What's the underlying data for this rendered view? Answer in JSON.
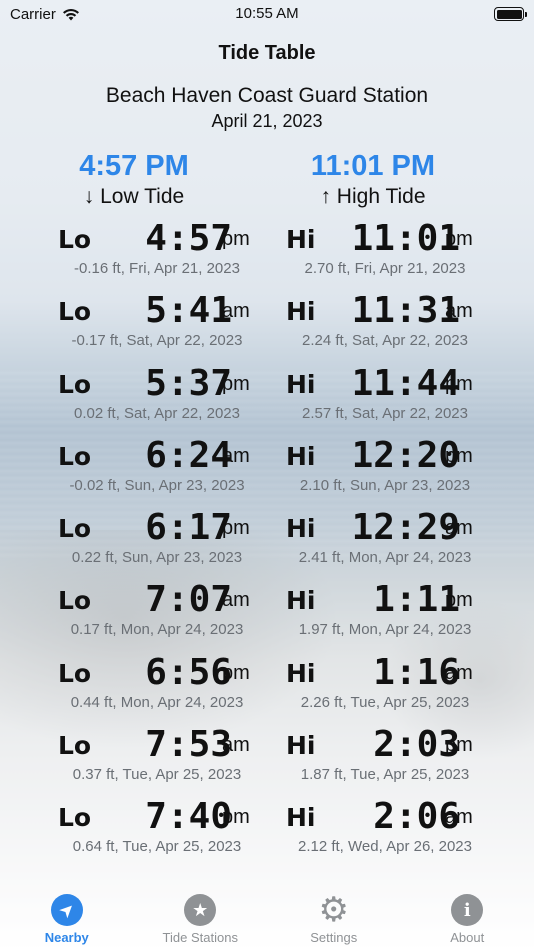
{
  "status_bar": {
    "carrier": "Carrier",
    "time": "10:55 AM"
  },
  "title": "Tide Table",
  "station": "Beach Haven Coast Guard Station",
  "date": "April 21, 2023",
  "next": {
    "low_time": "4:57 PM",
    "low_label": "↓ Low Tide",
    "high_time": "11:01 PM",
    "high_label": "↑ High Tide"
  },
  "rows": [
    {
      "lo": {
        "tag": "Lo",
        "time": "4:57",
        "ampm": "pm",
        "info": "-0.16 ft, Fri, Apr 21, 2023"
      },
      "hi": {
        "tag": "Hi",
        "time": "11:01",
        "ampm": "pm",
        "info": "2.70 ft, Fri, Apr 21, 2023"
      }
    },
    {
      "lo": {
        "tag": "Lo",
        "time": "5:41",
        "ampm": "am",
        "info": "-0.17 ft, Sat, Apr 22, 2023"
      },
      "hi": {
        "tag": "Hi",
        "time": "11:31",
        "ampm": "am",
        "info": "2.24 ft, Sat, Apr 22, 2023"
      }
    },
    {
      "lo": {
        "tag": "Lo",
        "time": "5:37",
        "ampm": "pm",
        "info": "0.02 ft, Sat, Apr 22, 2023"
      },
      "hi": {
        "tag": "Hi",
        "time": "11:44",
        "ampm": "pm",
        "info": "2.57 ft, Sat, Apr 22, 2023"
      }
    },
    {
      "lo": {
        "tag": "Lo",
        "time": "6:24",
        "ampm": "am",
        "info": "-0.02 ft, Sun, Apr 23, 2023"
      },
      "hi": {
        "tag": "Hi",
        "time": "12:20",
        "ampm": "pm",
        "info": "2.10 ft, Sun, Apr 23, 2023"
      }
    },
    {
      "lo": {
        "tag": "Lo",
        "time": "6:17",
        "ampm": "pm",
        "info": "0.22 ft, Sun, Apr 23, 2023"
      },
      "hi": {
        "tag": "Hi",
        "time": "12:29",
        "ampm": "am",
        "info": "2.41 ft, Mon, Apr 24, 2023"
      }
    },
    {
      "lo": {
        "tag": "Lo",
        "time": "7:07",
        "ampm": "am",
        "info": "0.17 ft, Mon, Apr 24, 2023"
      },
      "hi": {
        "tag": "Hi",
        "time": "1:11",
        "ampm": "pm",
        "info": "1.97 ft, Mon, Apr 24, 2023"
      }
    },
    {
      "lo": {
        "tag": "Lo",
        "time": "6:56",
        "ampm": "pm",
        "info": "0.44 ft, Mon, Apr 24, 2023"
      },
      "hi": {
        "tag": "Hi",
        "time": "1:16",
        "ampm": "am",
        "info": "2.26 ft, Tue, Apr 25, 2023"
      }
    },
    {
      "lo": {
        "tag": "Lo",
        "time": "7:53",
        "ampm": "am",
        "info": "0.37 ft, Tue, Apr 25, 2023"
      },
      "hi": {
        "tag": "Hi",
        "time": "2:03",
        "ampm": "pm",
        "info": "1.87 ft, Tue, Apr 25, 2023"
      }
    },
    {
      "lo": {
        "tag": "Lo",
        "time": "7:40",
        "ampm": "pm",
        "info": "0.64 ft, Tue, Apr 25, 2023"
      },
      "hi": {
        "tag": "Hi",
        "time": "2:06",
        "ampm": "am",
        "info": "2.12 ft, Wed, Apr 26, 2023"
      }
    }
  ],
  "tabs": [
    {
      "label": "Nearby",
      "icon": "location-arrow-icon",
      "glyph": "➤",
      "active": true
    },
    {
      "label": "Tide Stations",
      "icon": "star-icon",
      "glyph": "★",
      "active": false
    },
    {
      "label": "Settings",
      "icon": "gear-icon",
      "glyph": "⚙",
      "active": false
    },
    {
      "label": "About",
      "icon": "info-icon",
      "glyph": "i",
      "active": false
    }
  ],
  "colors": {
    "accent": "#2e86e8",
    "inactive": "#8f9295"
  }
}
